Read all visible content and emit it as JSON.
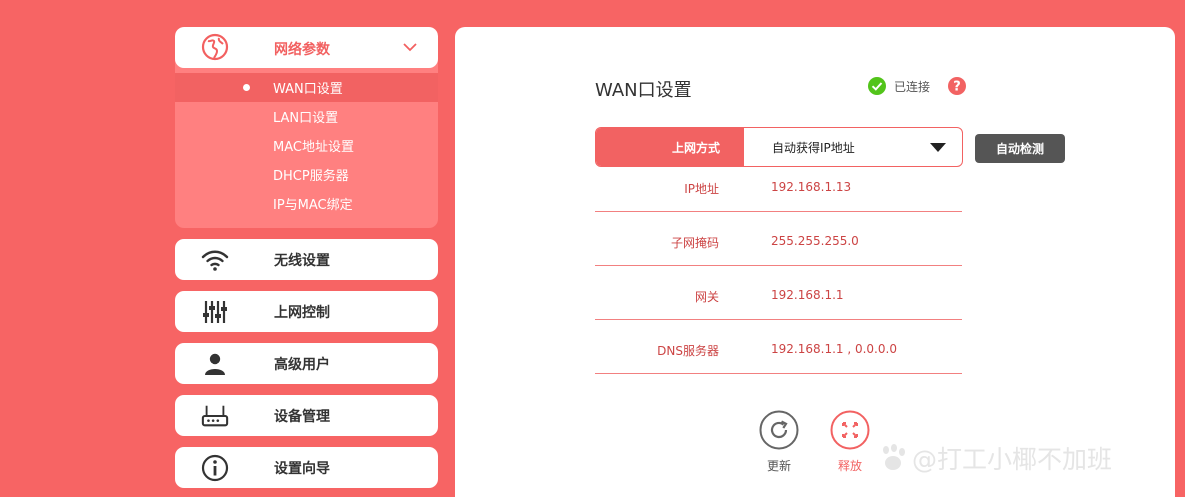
{
  "sidebar": {
    "network_group": {
      "label": "网络参数",
      "items": [
        {
          "label": "WAN口设置",
          "active": true
        },
        {
          "label": "LAN口设置",
          "active": false
        },
        {
          "label": "MAC地址设置",
          "active": false
        },
        {
          "label": "DHCP服务器",
          "active": false
        },
        {
          "label": "IP与MAC绑定",
          "active": false
        }
      ]
    },
    "wireless": {
      "label": "无线设置",
      "icon": "wifi-icon"
    },
    "access_control": {
      "label": "上网控制",
      "icon": "sliders-icon"
    },
    "advanced_user": {
      "label": "高级用户",
      "icon": "user-icon"
    },
    "device_mgmt": {
      "label": "设备管理",
      "icon": "router-icon"
    },
    "setup_wizard": {
      "label": "设置向导",
      "icon": "info-icon"
    }
  },
  "main": {
    "title": "WAN口设置",
    "status": {
      "text": "已连接",
      "color": "#52c41a"
    },
    "connection_type": {
      "label": "上网方式",
      "value": "自动获得IP地址"
    },
    "auto_detect_label": "自动检测",
    "info": [
      {
        "key": "IP地址",
        "value": "192.168.1.13"
      },
      {
        "key": "子网掩码",
        "value": "255.255.255.0"
      },
      {
        "key": "网关",
        "value": "192.168.1.1"
      },
      {
        "key": "DNS服务器",
        "value": "192.168.1.1 , 0.0.0.0"
      }
    ],
    "actions": {
      "renew": "更新",
      "release": "释放"
    }
  },
  "watermark": "@打工小椰不加班",
  "colors": {
    "accent": "#f26262",
    "background": "#f76464",
    "button_dark": "#555555"
  }
}
